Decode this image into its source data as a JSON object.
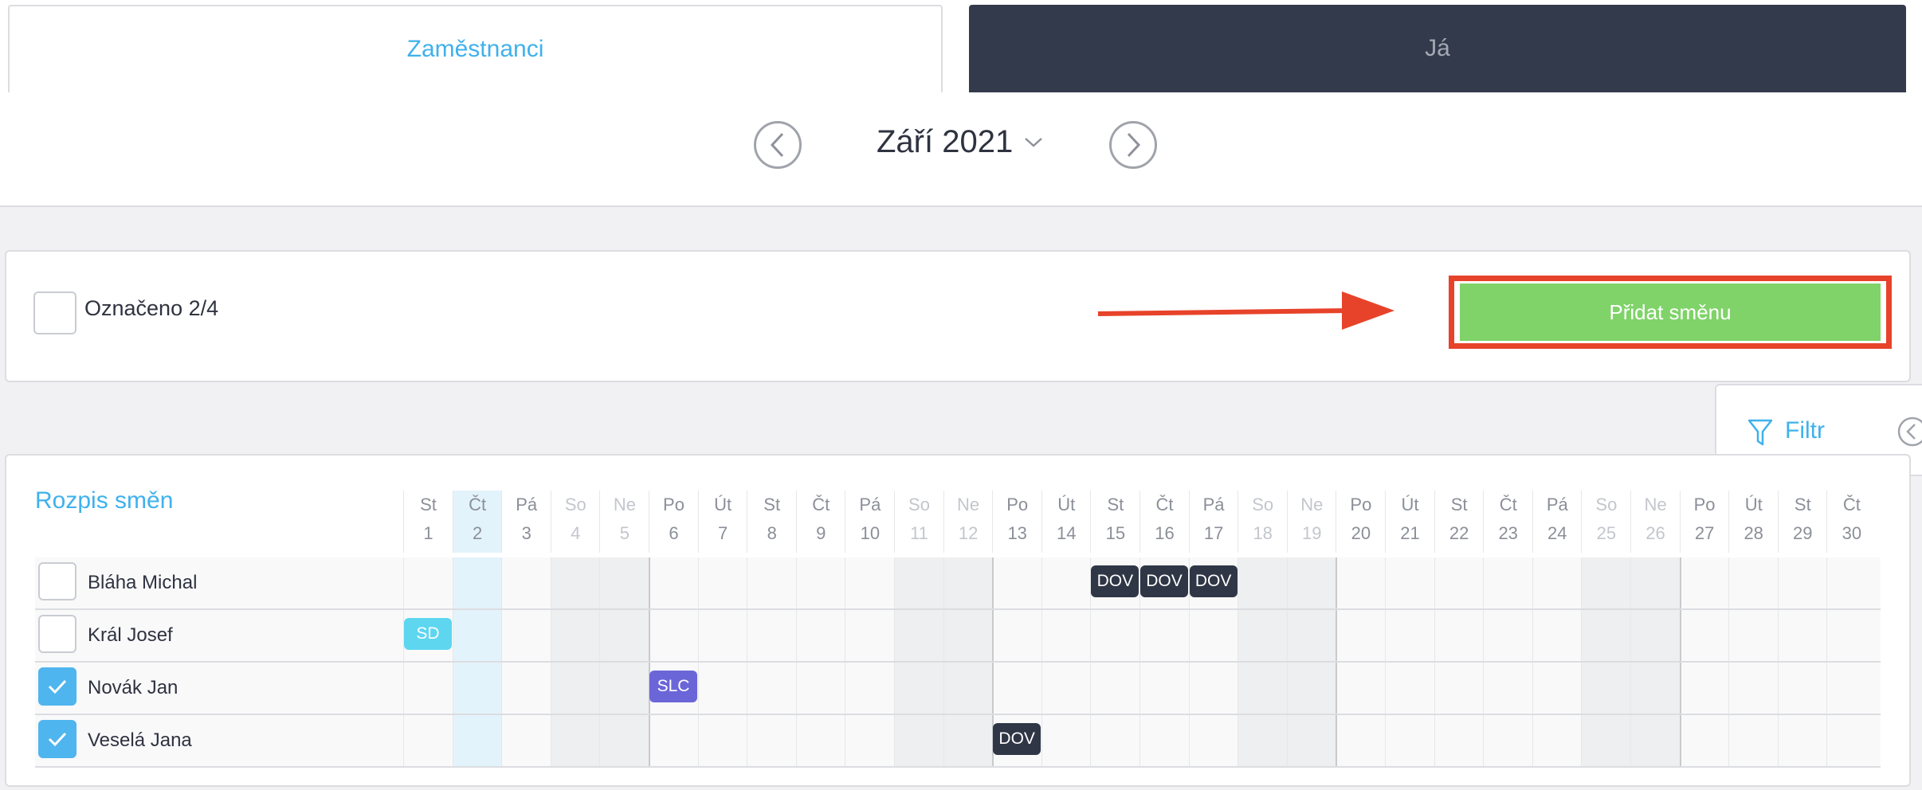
{
  "tabs": [
    {
      "label": "Zaměstnanci",
      "active": true
    },
    {
      "label": "Já",
      "active": false
    }
  ],
  "month": {
    "label": "Září 2021"
  },
  "toolbar": {
    "selected_label": "Označeno 2/4",
    "add_shift_label": "Přidat směnu"
  },
  "filter": {
    "label": "Filtr"
  },
  "schedule": {
    "title": "Rozpis směn",
    "today_day": 2,
    "days": [
      {
        "dow": "St",
        "day": "1"
      },
      {
        "dow": "Čt",
        "day": "2"
      },
      {
        "dow": "Pá",
        "day": "3"
      },
      {
        "dow": "So",
        "day": "4"
      },
      {
        "dow": "Ne",
        "day": "5"
      },
      {
        "dow": "Po",
        "day": "6"
      },
      {
        "dow": "Út",
        "day": "7"
      },
      {
        "dow": "St",
        "day": "8"
      },
      {
        "dow": "Čt",
        "day": "9"
      },
      {
        "dow": "Pá",
        "day": "10"
      },
      {
        "dow": "So",
        "day": "11"
      },
      {
        "dow": "Ne",
        "day": "12"
      },
      {
        "dow": "Po",
        "day": "13"
      },
      {
        "dow": "Út",
        "day": "14"
      },
      {
        "dow": "St",
        "day": "15"
      },
      {
        "dow": "Čt",
        "day": "16"
      },
      {
        "dow": "Pá",
        "day": "17"
      },
      {
        "dow": "So",
        "day": "18"
      },
      {
        "dow": "Ne",
        "day": "19"
      },
      {
        "dow": "Po",
        "day": "20"
      },
      {
        "dow": "Út",
        "day": "21"
      },
      {
        "dow": "St",
        "day": "22"
      },
      {
        "dow": "Čt",
        "day": "23"
      },
      {
        "dow": "Pá",
        "day": "24"
      },
      {
        "dow": "So",
        "day": "25"
      },
      {
        "dow": "Ne",
        "day": "26"
      },
      {
        "dow": "Po",
        "day": "27"
      },
      {
        "dow": "Út",
        "day": "28"
      },
      {
        "dow": "St",
        "day": "29"
      },
      {
        "dow": "Čt",
        "day": "30"
      }
    ],
    "employees": [
      {
        "name": "Bláha Michal",
        "checked": false,
        "shifts": [
          {
            "day": 15,
            "code": "DOV",
            "color": "#2f3646"
          },
          {
            "day": 16,
            "code": "DOV",
            "color": "#2f3646"
          },
          {
            "day": 17,
            "code": "DOV",
            "color": "#2f3646"
          }
        ]
      },
      {
        "name": "Král Josef",
        "checked": false,
        "shifts": [
          {
            "day": 1,
            "code": "SD",
            "color": "#5ed6f0"
          }
        ]
      },
      {
        "name": "Novák Jan",
        "checked": true,
        "shifts": [
          {
            "day": 6,
            "code": "SLC",
            "color": "#6b66d8"
          }
        ]
      },
      {
        "name": "Veselá Jana",
        "checked": true,
        "shifts": [
          {
            "day": 13,
            "code": "DOV",
            "color": "#2f3646"
          }
        ]
      }
    ]
  },
  "colors": {
    "accent": "#3fb1ec",
    "add_button": "#7fd369",
    "highlight": "#e7432a",
    "dark_tab": "#333a4b"
  }
}
